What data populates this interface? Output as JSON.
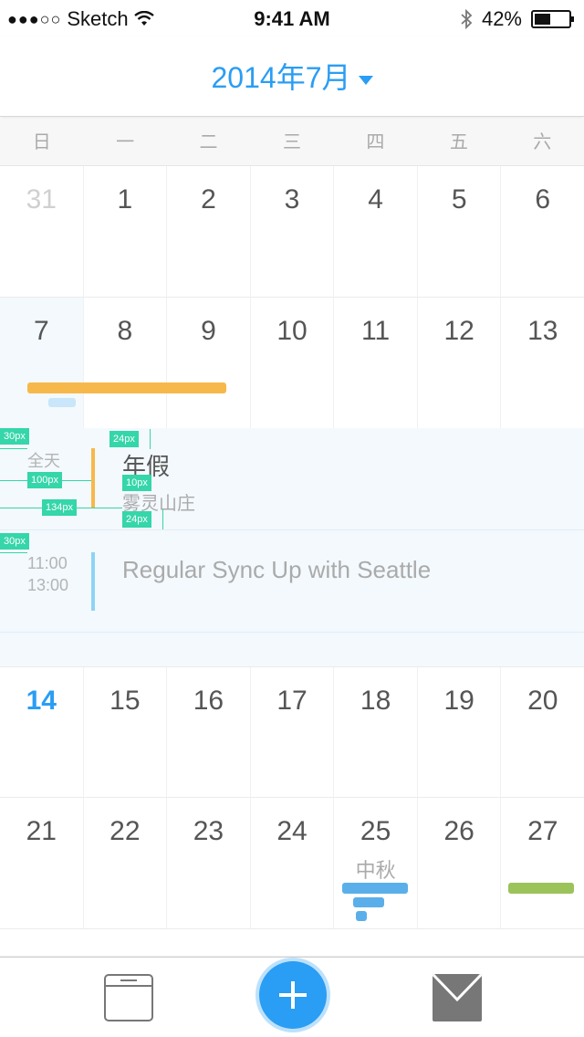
{
  "status_bar": {
    "carrier": "Sketch",
    "signal": "●●●○○",
    "time": "9:41 AM",
    "battery": "42%"
  },
  "header": {
    "month": "2014年7月"
  },
  "weekdays": [
    "日",
    "一",
    "二",
    "三",
    "四",
    "五",
    "六"
  ],
  "weeks": [
    [
      "31",
      "1",
      "2",
      "3",
      "4",
      "5",
      "6"
    ],
    [
      "7",
      "8",
      "9",
      "10",
      "11",
      "12",
      "13"
    ],
    [
      "14",
      "15",
      "16",
      "17",
      "18",
      "19",
      "20"
    ],
    [
      "21",
      "22",
      "23",
      "24",
      "25",
      "26",
      "27"
    ]
  ],
  "holiday": {
    "day": "25",
    "label": "中秋"
  },
  "events": [
    {
      "time": "全天",
      "title": "年假",
      "location": "雾灵山庄",
      "color": "#f7b84b"
    },
    {
      "start": "11:00",
      "end": "13:00",
      "title": "Regular Sync Up with Seattle",
      "color": "#8fd3f4"
    }
  ],
  "annotations": [
    "30px",
    "100px",
    "134px",
    "24px",
    "10px",
    "24px",
    "30px"
  ],
  "colors": {
    "accent": "#2a9df4",
    "annual_leave": "#f7b84b",
    "meeting": "#8fd3f4",
    "mid_autumn": "#5aafea",
    "green_event": "#9bc35a"
  }
}
